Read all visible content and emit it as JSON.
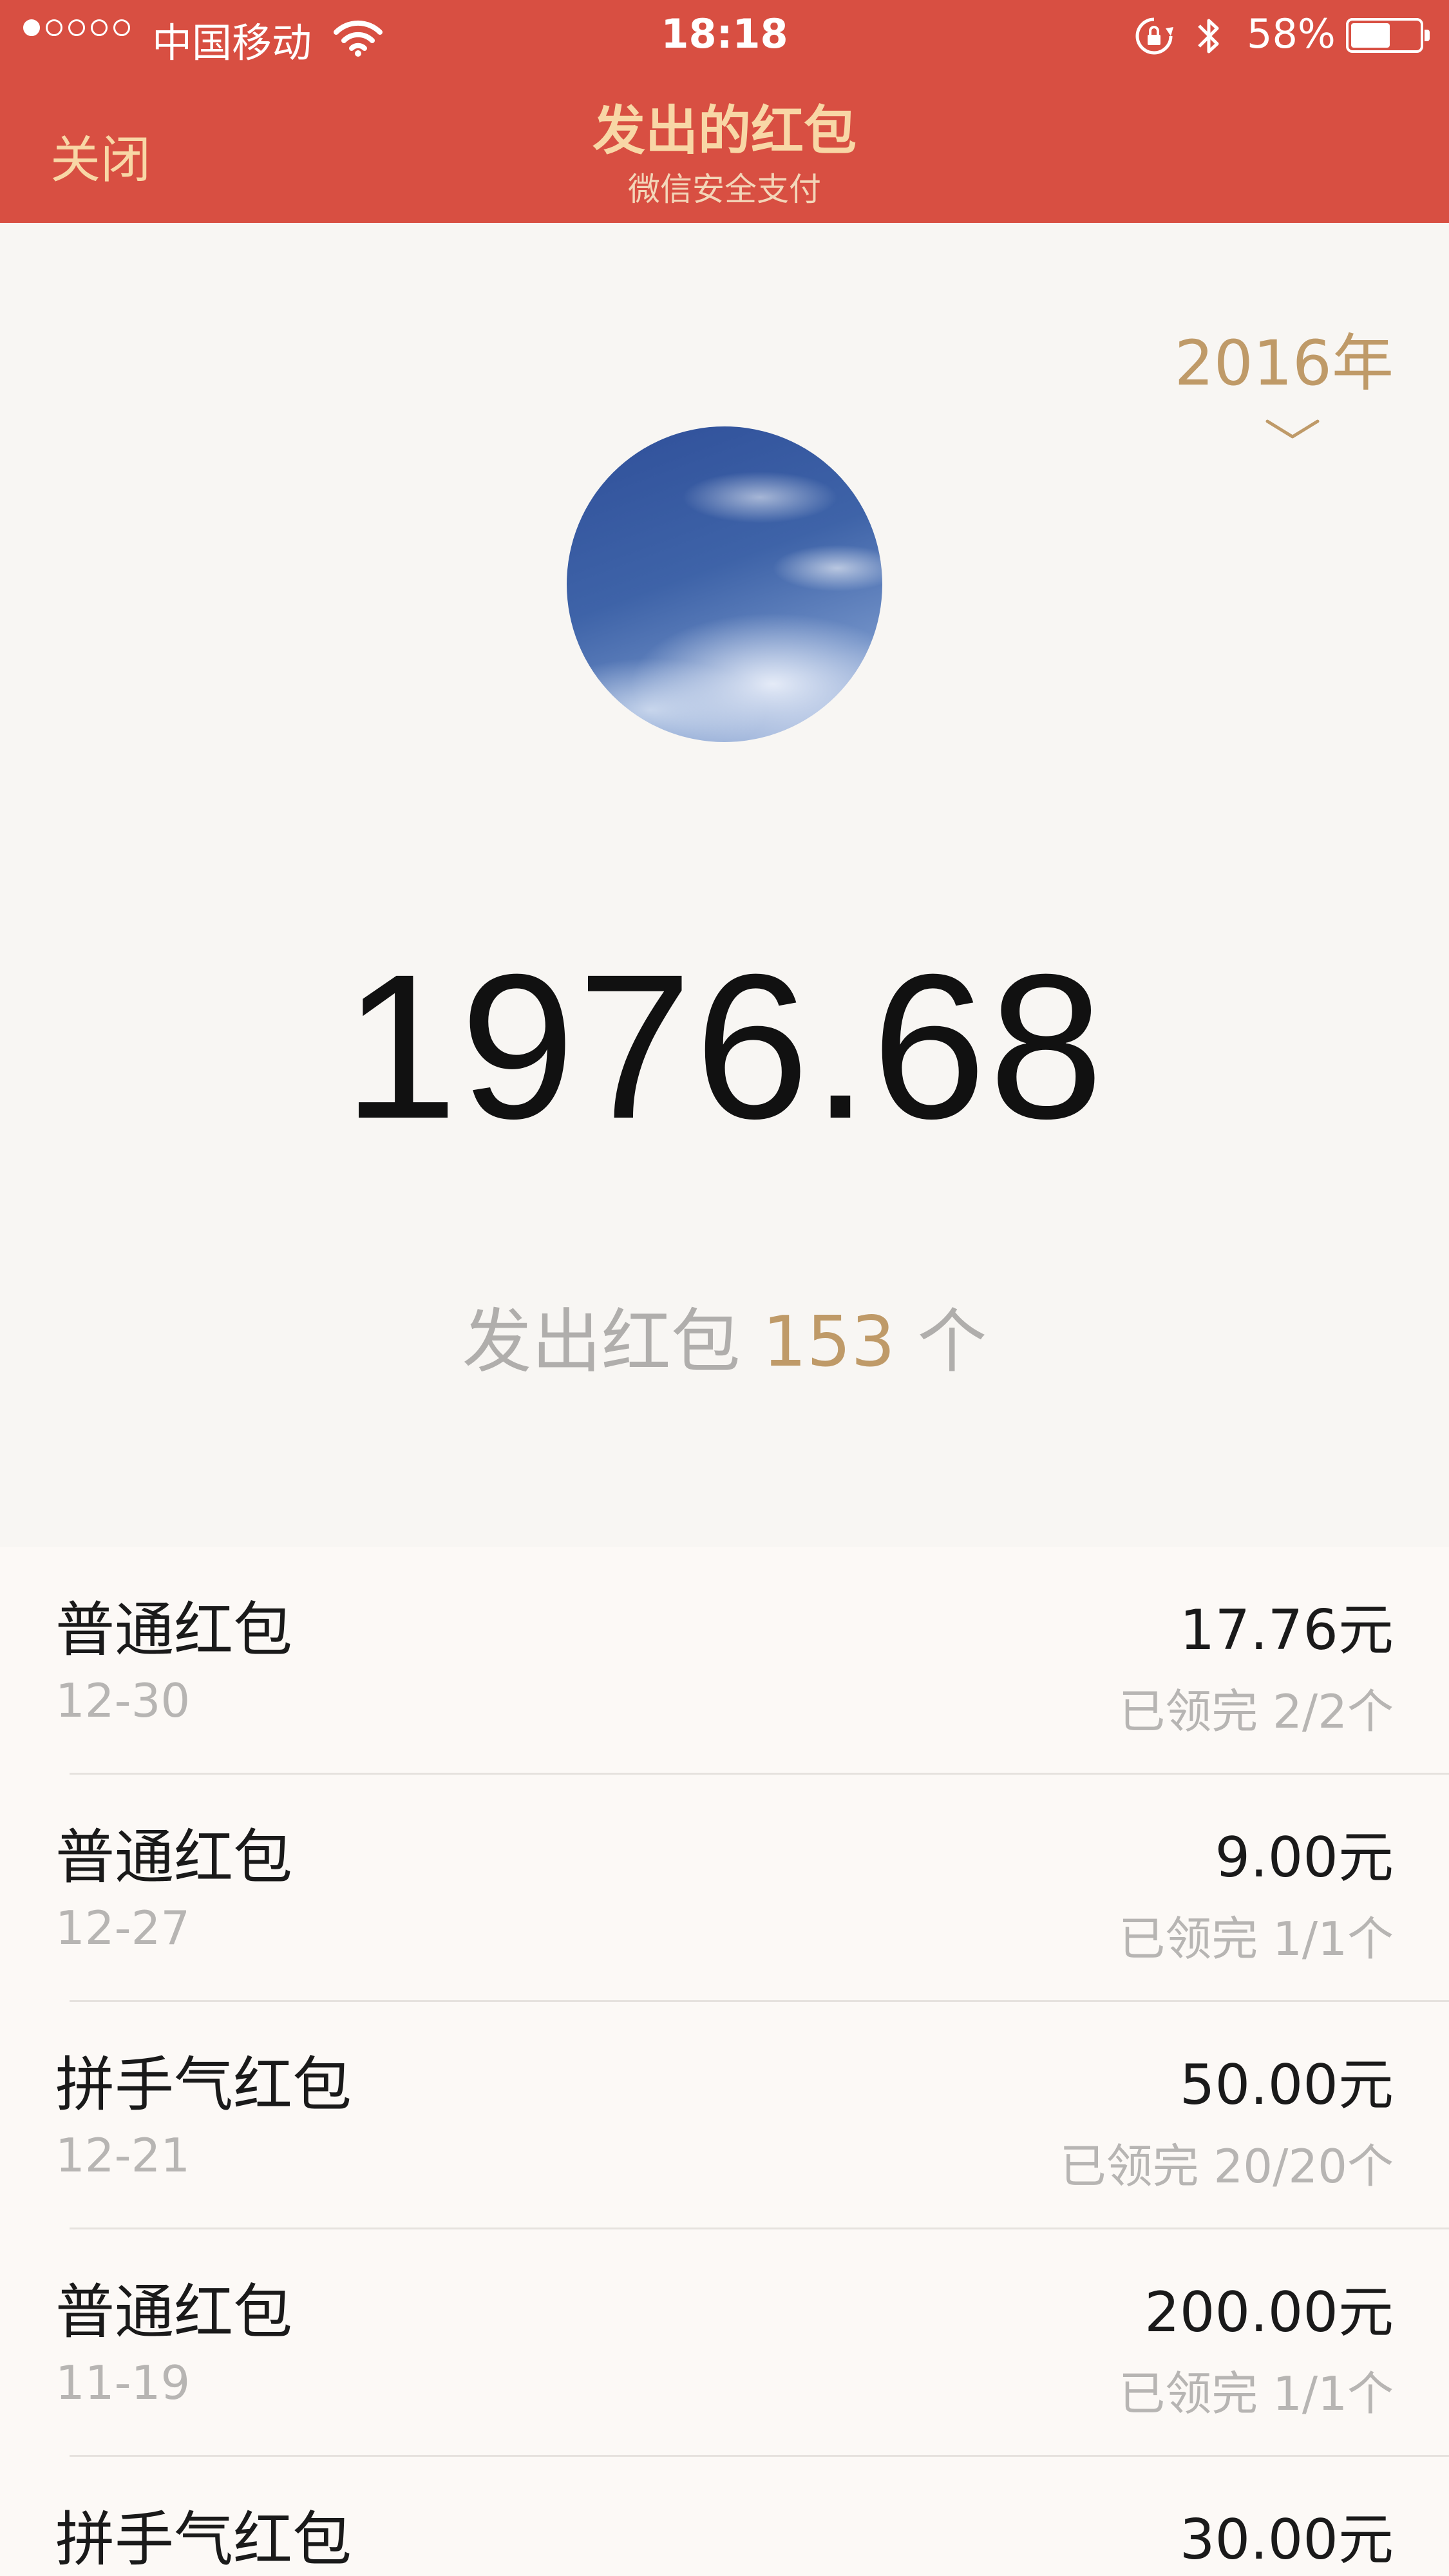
{
  "status_bar": {
    "carrier": "中国移动",
    "time": "18:18",
    "battery": "58%",
    "battery_level": 0.58,
    "signal_dots_filled": 1,
    "signal_dots_total": 5
  },
  "nav": {
    "close_label": "关闭",
    "title": "发出的红包",
    "subtitle": "微信安全支付"
  },
  "summary": {
    "year": "2016年",
    "total_amount": "1976.68",
    "count_prefix": "发出红包",
    "count_value": "153",
    "count_suffix": "个"
  },
  "colors": {
    "header_bg": "#d84f42",
    "gold": "#bf9a68",
    "header_text": "#f8d7a6"
  },
  "records": [
    {
      "type": "普通红包",
      "date": "12-30",
      "amount": "17.76元",
      "status": "已领完 2/2个"
    },
    {
      "type": "普通红包",
      "date": "12-27",
      "amount": "9.00元",
      "status": "已领完 1/1个"
    },
    {
      "type": "拼手气红包",
      "date": "12-21",
      "amount": "50.00元",
      "status": "已领完 20/20个"
    },
    {
      "type": "普通红包",
      "date": "11-19",
      "amount": "200.00元",
      "status": "已领完 1/1个"
    },
    {
      "type": "拼手气红包",
      "date": "",
      "amount": "30.00元",
      "status": ""
    }
  ]
}
